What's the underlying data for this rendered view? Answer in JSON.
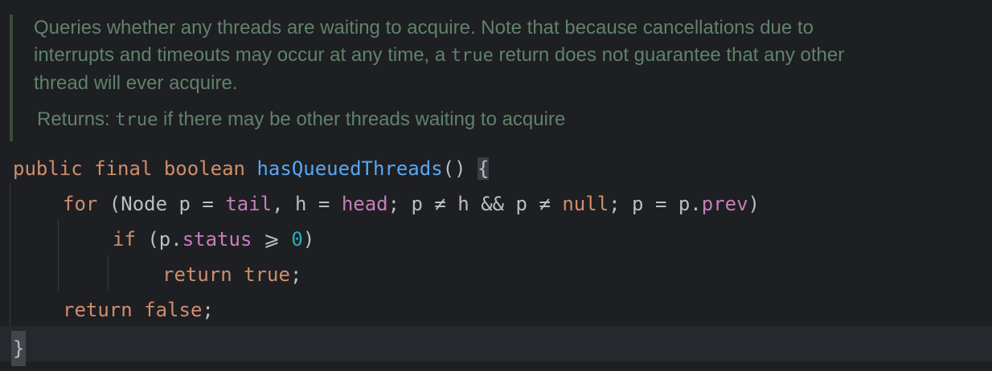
{
  "doc": {
    "line1": "Queries whether any threads are waiting to acquire. Note that because cancellations due to",
    "line2_pre": "interrupts and timeouts may occur at any time, a ",
    "line2_code": "true",
    "line2_post": " return does not guarantee that any other",
    "line3": "thread will ever acquire.",
    "returns_label": "Returns: ",
    "returns_code": "true",
    "returns_text": " if there may be other threads waiting to acquire"
  },
  "code": {
    "l1": {
      "kw1": "public",
      "kw2": "final",
      "kw3": "boolean",
      "fn": "hasQueuedThreads",
      "parens": "()",
      "brace": "{"
    },
    "l2": {
      "kw": "for",
      "t1": " (Node p = ",
      "f1": "tail",
      "t2": ", h = ",
      "f2": "head",
      "t3": "; p ≠ h && p ≠ ",
      "kw2": "null",
      "t4": "; p = p.",
      "f3": "prev",
      "t5": ")"
    },
    "l3": {
      "kw": "if",
      "t1": " (p.",
      "f1": "status",
      "t2": " ⩾ ",
      "num": "0",
      "t3": ")"
    },
    "l4": {
      "kw1": "return",
      "kw2": "true",
      "t": ";"
    },
    "l5": {
      "kw1": "return",
      "kw2": "false",
      "t": ";"
    },
    "l6": {
      "brace": "}"
    }
  }
}
